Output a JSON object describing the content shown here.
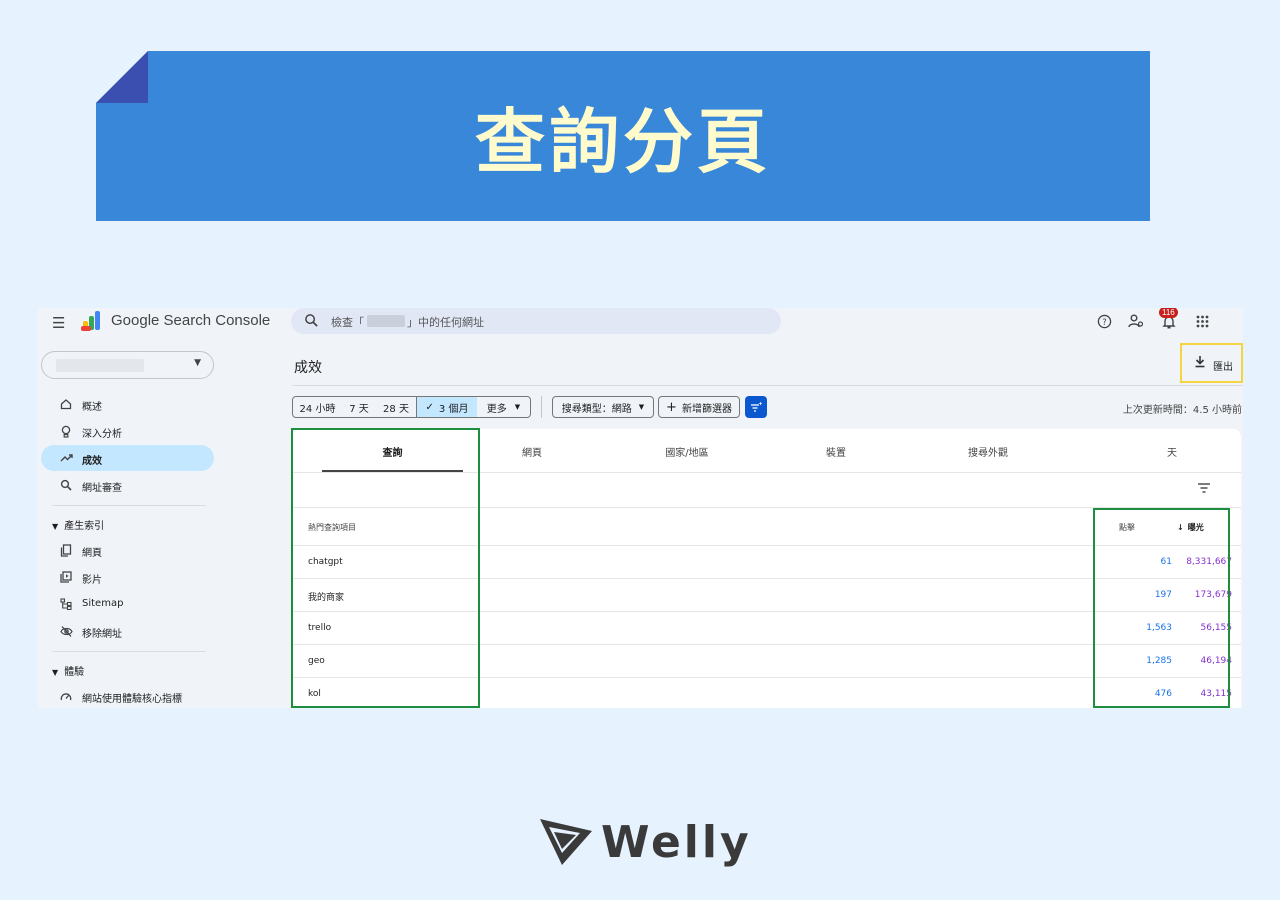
{
  "banner": {
    "title": "查詢分頁",
    "accent": "#3887d9",
    "title_color": "#fffbcc"
  },
  "header": {
    "app_name": "Google Search Console",
    "search_placeholder_prefix": "檢查「",
    "search_placeholder_suffix": "」中的任何網址",
    "notification_count": "116"
  },
  "sidebar": {
    "items": [
      {
        "label": "概述",
        "icon": "home-icon"
      },
      {
        "label": "深入分析",
        "icon": "lightbulb-icon"
      },
      {
        "label": "成效",
        "icon": "trending-up-icon",
        "active": true
      },
      {
        "label": "網址審查",
        "icon": "search-icon"
      }
    ],
    "section_index": "產生索引",
    "index_items": [
      {
        "label": "網頁",
        "icon": "pages-icon"
      },
      {
        "label": "影片",
        "icon": "video-icon"
      },
      {
        "label": "Sitemap",
        "icon": "sitemap-icon"
      },
      {
        "label": "移除網址",
        "icon": "visibility-off-icon"
      }
    ],
    "section_experience": "體驗",
    "experience_items": [
      {
        "label": "網站使用體驗核心指標",
        "icon": "speed-icon"
      }
    ]
  },
  "main": {
    "title": "成效",
    "export_label": "匯出",
    "date_chips": [
      "24 小時",
      "7 天",
      "28 天",
      "3 個月",
      "更多"
    ],
    "search_type": "搜尋類型：網路",
    "add_filter": "新增篩選器",
    "last_updated": "上次更新時間：4.5 小時前",
    "tabs": [
      "查詢",
      "網頁",
      "國家/地區",
      "裝置",
      "搜尋外觀",
      "天"
    ],
    "table": {
      "col_query": "熱門查詢項目",
      "col_clicks": "點擊",
      "col_impressions": "曝光",
      "rows": [
        {
          "query": "chatgpt",
          "clicks": "61",
          "impressions": "8,331,667"
        },
        {
          "query": "我的商家",
          "clicks": "197",
          "impressions": "173,679"
        },
        {
          "query": "trello",
          "clicks": "1,563",
          "impressions": "56,155"
        },
        {
          "query": "geo",
          "clicks": "1,285",
          "impressions": "46,194"
        },
        {
          "query": "kol",
          "clicks": "476",
          "impressions": "43,115"
        }
      ]
    }
  },
  "footer": {
    "brand": "Welly"
  }
}
